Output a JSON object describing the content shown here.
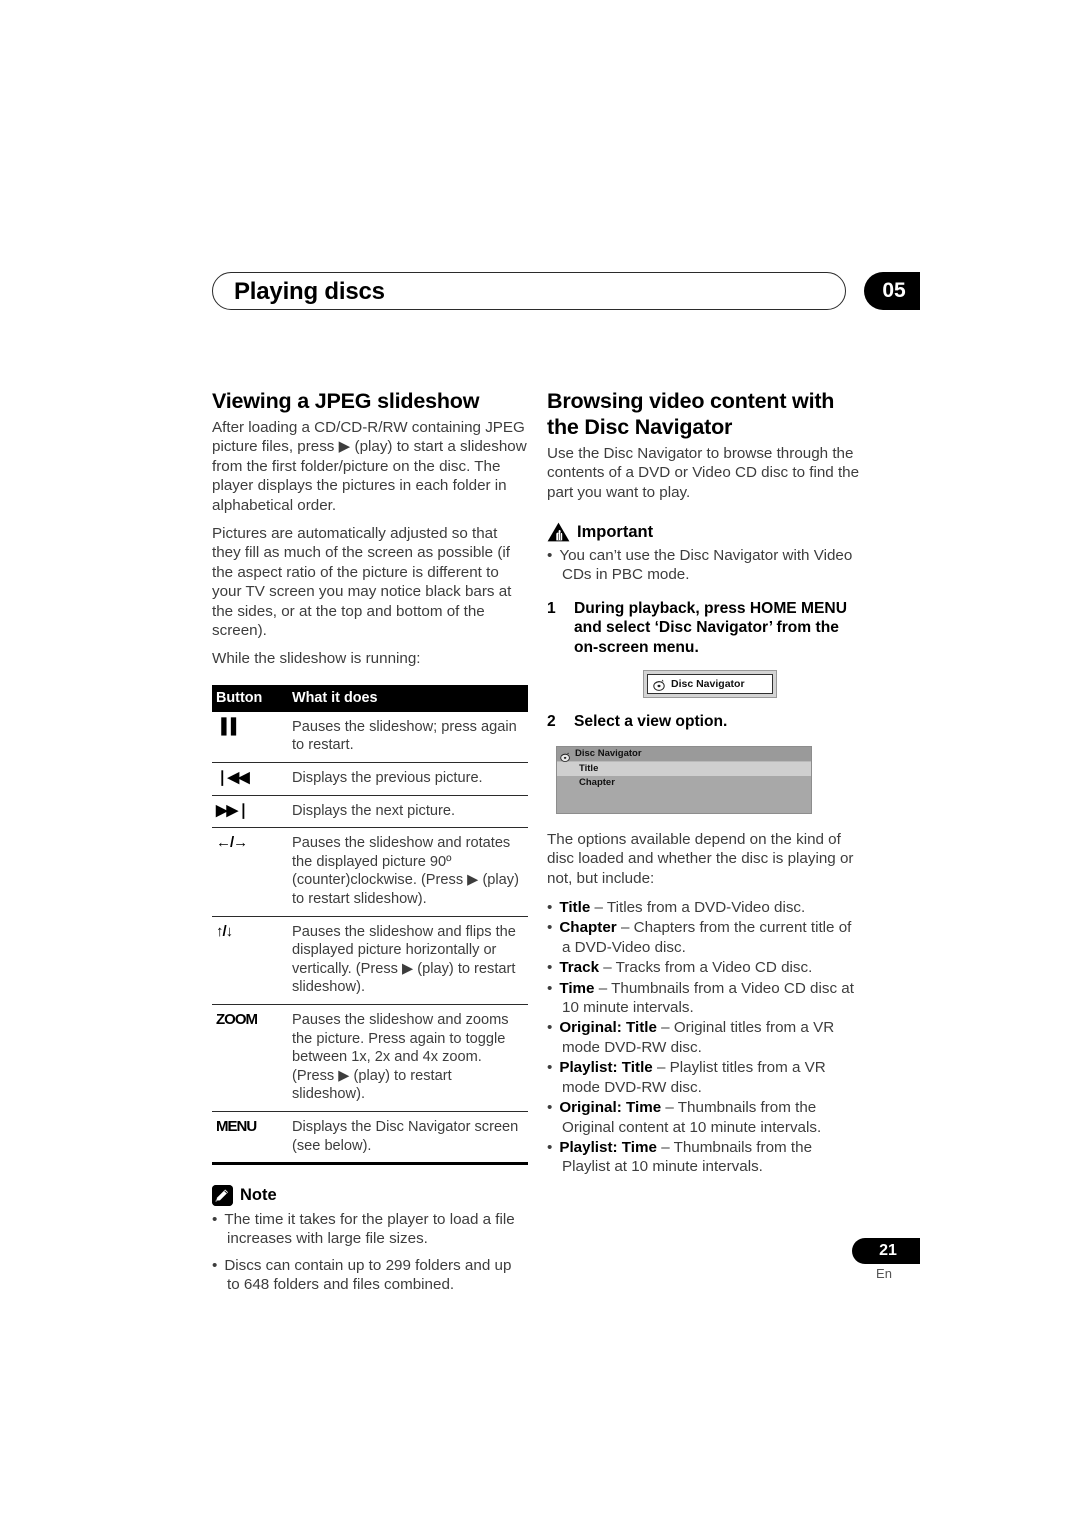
{
  "header": {
    "title": "Playing discs",
    "chapter_number": "05"
  },
  "left_column": {
    "heading": "Viewing a JPEG slideshow",
    "paragraphs": [
      "After loading a CD/CD-R/RW containing JPEG picture files, press ▶ (play) to start a slideshow from the first folder/picture on the disc. The player displays the pictures in each folder in alphabetical order.",
      "Pictures are automatically adjusted so that they fill as much of the screen as possible (if the aspect ratio of the picture is different to your TV screen you may notice black bars at the sides, or at the top and bottom of the screen).",
      "While the slideshow is running:"
    ],
    "table": {
      "columns": [
        "Button",
        "What it does"
      ],
      "rows": [
        {
          "button": "▐▐",
          "button_name": "pause-button",
          "description": "Pauses the slideshow; press again to restart."
        },
        {
          "button": "❘◀◀",
          "button_name": "previous-button",
          "description": "Displays the previous picture."
        },
        {
          "button": "▶▶❘",
          "button_name": "next-button",
          "description": "Displays the next picture."
        },
        {
          "button": "←/→",
          "button_name": "left-right-arrow-button",
          "description": "Pauses the slideshow and rotates the displayed picture 90º (counter)clockwise. (Press ▶ (play) to restart slideshow)."
        },
        {
          "button": "↑/↓",
          "button_name": "up-down-arrow-button",
          "description": "Pauses the slideshow and flips the displayed picture horizontally or vertically. (Press ▶ (play) to restart slideshow)."
        },
        {
          "button": "ZOOM",
          "button_name": "zoom-button",
          "description": "Pauses the slideshow and zooms the picture. Press again to toggle between 1x, 2x and 4x zoom. (Press ▶ (play) to restart slideshow)."
        },
        {
          "button": "MENU",
          "button_name": "menu-button",
          "description": "Displays the Disc Navigator screen (see below)."
        }
      ]
    },
    "note": {
      "label": "Note",
      "items": [
        "The time it takes for the player to load a file increases with large file sizes.",
        "Discs can contain up to 299 folders and up to 648 folders and files combined."
      ]
    }
  },
  "right_column": {
    "heading": "Browsing video content with the Disc Navigator",
    "intro": "Use the Disc Navigator to browse through the contents of a DVD or Video CD disc to find the part you want to play.",
    "important": {
      "label": "Important",
      "items": [
        "You can’t use the Disc Navigator with Video CDs in PBC mode."
      ]
    },
    "steps": [
      {
        "num": "1",
        "text": "During playback, press HOME MENU and select ‘Disc Navigator’ from the on-screen menu."
      },
      {
        "num": "2",
        "text": "Select a view option."
      }
    ],
    "osd_button": {
      "label": "Disc Navigator"
    },
    "osd_screen": {
      "title": "Disc Navigator",
      "rows": [
        {
          "label": "Title",
          "selected": true
        },
        {
          "label": "Chapter",
          "selected": false
        }
      ]
    },
    "options_intro": "The options available depend on the kind of disc loaded and whether the disc is playing or not, but include:",
    "options": [
      {
        "term": "Title",
        "desc": " – Titles from a DVD-Video disc."
      },
      {
        "term": "Chapter",
        "desc": " – Chapters from the current title of a DVD-Video disc."
      },
      {
        "term": "Track",
        "desc": " – Tracks from a Video CD disc."
      },
      {
        "term": "Time",
        "desc": " – Thumbnails from a Video CD disc at 10 minute intervals."
      },
      {
        "term": "Original: Title",
        "desc": " – Original titles from a VR mode DVD-RW disc."
      },
      {
        "term": "Playlist: Title",
        "desc": " – Playlist titles from a VR mode DVD-RW disc."
      },
      {
        "term": "Original: Time",
        "desc": " – Thumbnails from the Original content at 10 minute intervals."
      },
      {
        "term": "Playlist: Time",
        "desc": " – Thumbnails from the Playlist at 10 minute intervals."
      }
    ]
  },
  "footer": {
    "page_number": "21",
    "language": "En"
  }
}
